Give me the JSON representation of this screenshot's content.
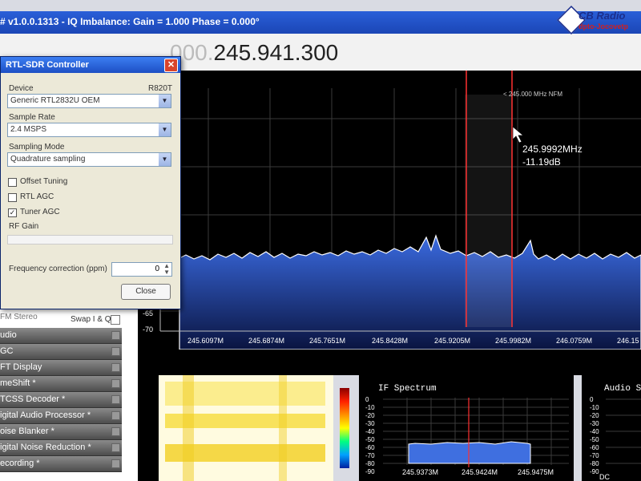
{
  "app": {
    "title": "# v1.0.0.1313 - IQ Imbalance: Gain = 1.000 Phase = 0.000°",
    "frequency_dim": "000.",
    "frequency": "245.941.300"
  },
  "logo": {
    "name": "CB Radio",
    "sub": "dpto-Jocovetp"
  },
  "spectrum": {
    "center_label": "< 245.000 MHz NFM",
    "cursor_freq": "245.9992MHz",
    "cursor_db": "-11.19dB",
    "y_labels": [
      "-65",
      "-70"
    ],
    "x_labels": [
      "245.6097M",
      "245.6874M",
      "245.7651M",
      "245.8428M",
      "245.9205M",
      "245.9982M",
      "246.0759M",
      "246.15"
    ]
  },
  "dialog": {
    "title": "RTL-SDR Controller",
    "device_label": "Device",
    "tuner": "R820T",
    "device_value": "Generic RTL2832U OEM",
    "sample_rate_label": "Sample Rate",
    "sample_rate_value": "2.4 MSPS",
    "sampling_mode_label": "Sampling Mode",
    "sampling_mode_value": "Quadrature sampling",
    "offset_tuning": "Offset Tuning",
    "rtl_agc": "RTL AGC",
    "tuner_agc": "Tuner AGC",
    "rf_gain": "RF Gain",
    "freq_corr_label": "Frequency correction (ppm)",
    "freq_corr_value": "0",
    "close": "Close",
    "close_icon": "x-icon"
  },
  "left": {
    "fm_stereo": "FM Stereo",
    "swap": "Swap I & Q",
    "items": [
      "udio",
      "GC",
      "FT Display",
      "meShift *",
      "TCSS Decoder *",
      "igital Audio Processor *",
      "oise Blanker *",
      "igital Noise Reduction *",
      "ecording *"
    ]
  },
  "ifspectrum": {
    "title": "IF Spectrum",
    "y_labels": [
      "0",
      "-10",
      "-20",
      "-30",
      "-40",
      "-50",
      "-60",
      "-70",
      "-80",
      "-90"
    ],
    "x_labels": [
      "245.9373M",
      "245.9424M",
      "245.9475M"
    ]
  },
  "audio": {
    "title": "Audio S",
    "y_labels": [
      "0",
      "-10",
      "-20",
      "-30",
      "-40",
      "-50",
      "-60",
      "-70",
      "-80",
      "-90"
    ],
    "x_label": "DC"
  },
  "colors": {
    "accent": "#1d4fc4",
    "cursor_line": "#ff3030",
    "spectrum_fill": "#2f5fd0"
  }
}
